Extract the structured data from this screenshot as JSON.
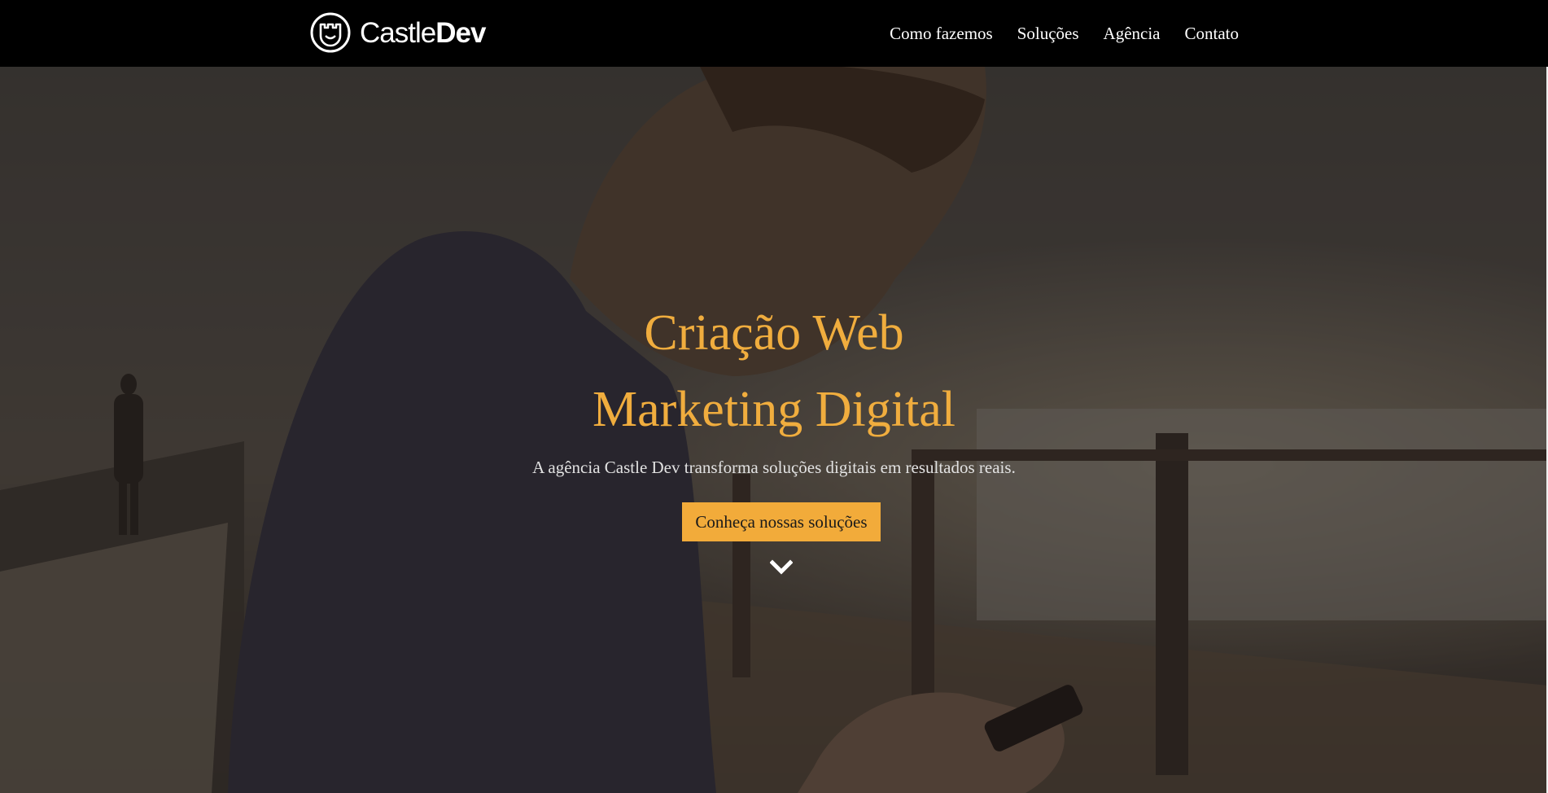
{
  "brand": {
    "name_light": "Castle",
    "name_bold": "Dev",
    "logo_icon": "castle-shield-logo"
  },
  "nav": {
    "items": [
      {
        "label": "Como fazemos"
      },
      {
        "label": "Soluções"
      },
      {
        "label": "Agência"
      },
      {
        "label": "Contato"
      }
    ]
  },
  "hero": {
    "title_line1": "Criação Web",
    "title_line2": "Marketing Digital",
    "subtitle": "A agência Castle Dev transforma soluções digitais em resultados reais.",
    "cta_label": "Conheça nossas soluções",
    "scroll_icon": "chevron-down-icon"
  },
  "colors": {
    "accent": "#f0ad3e",
    "nav_bg": "#000000",
    "button_bg": "#f2ab3a"
  }
}
